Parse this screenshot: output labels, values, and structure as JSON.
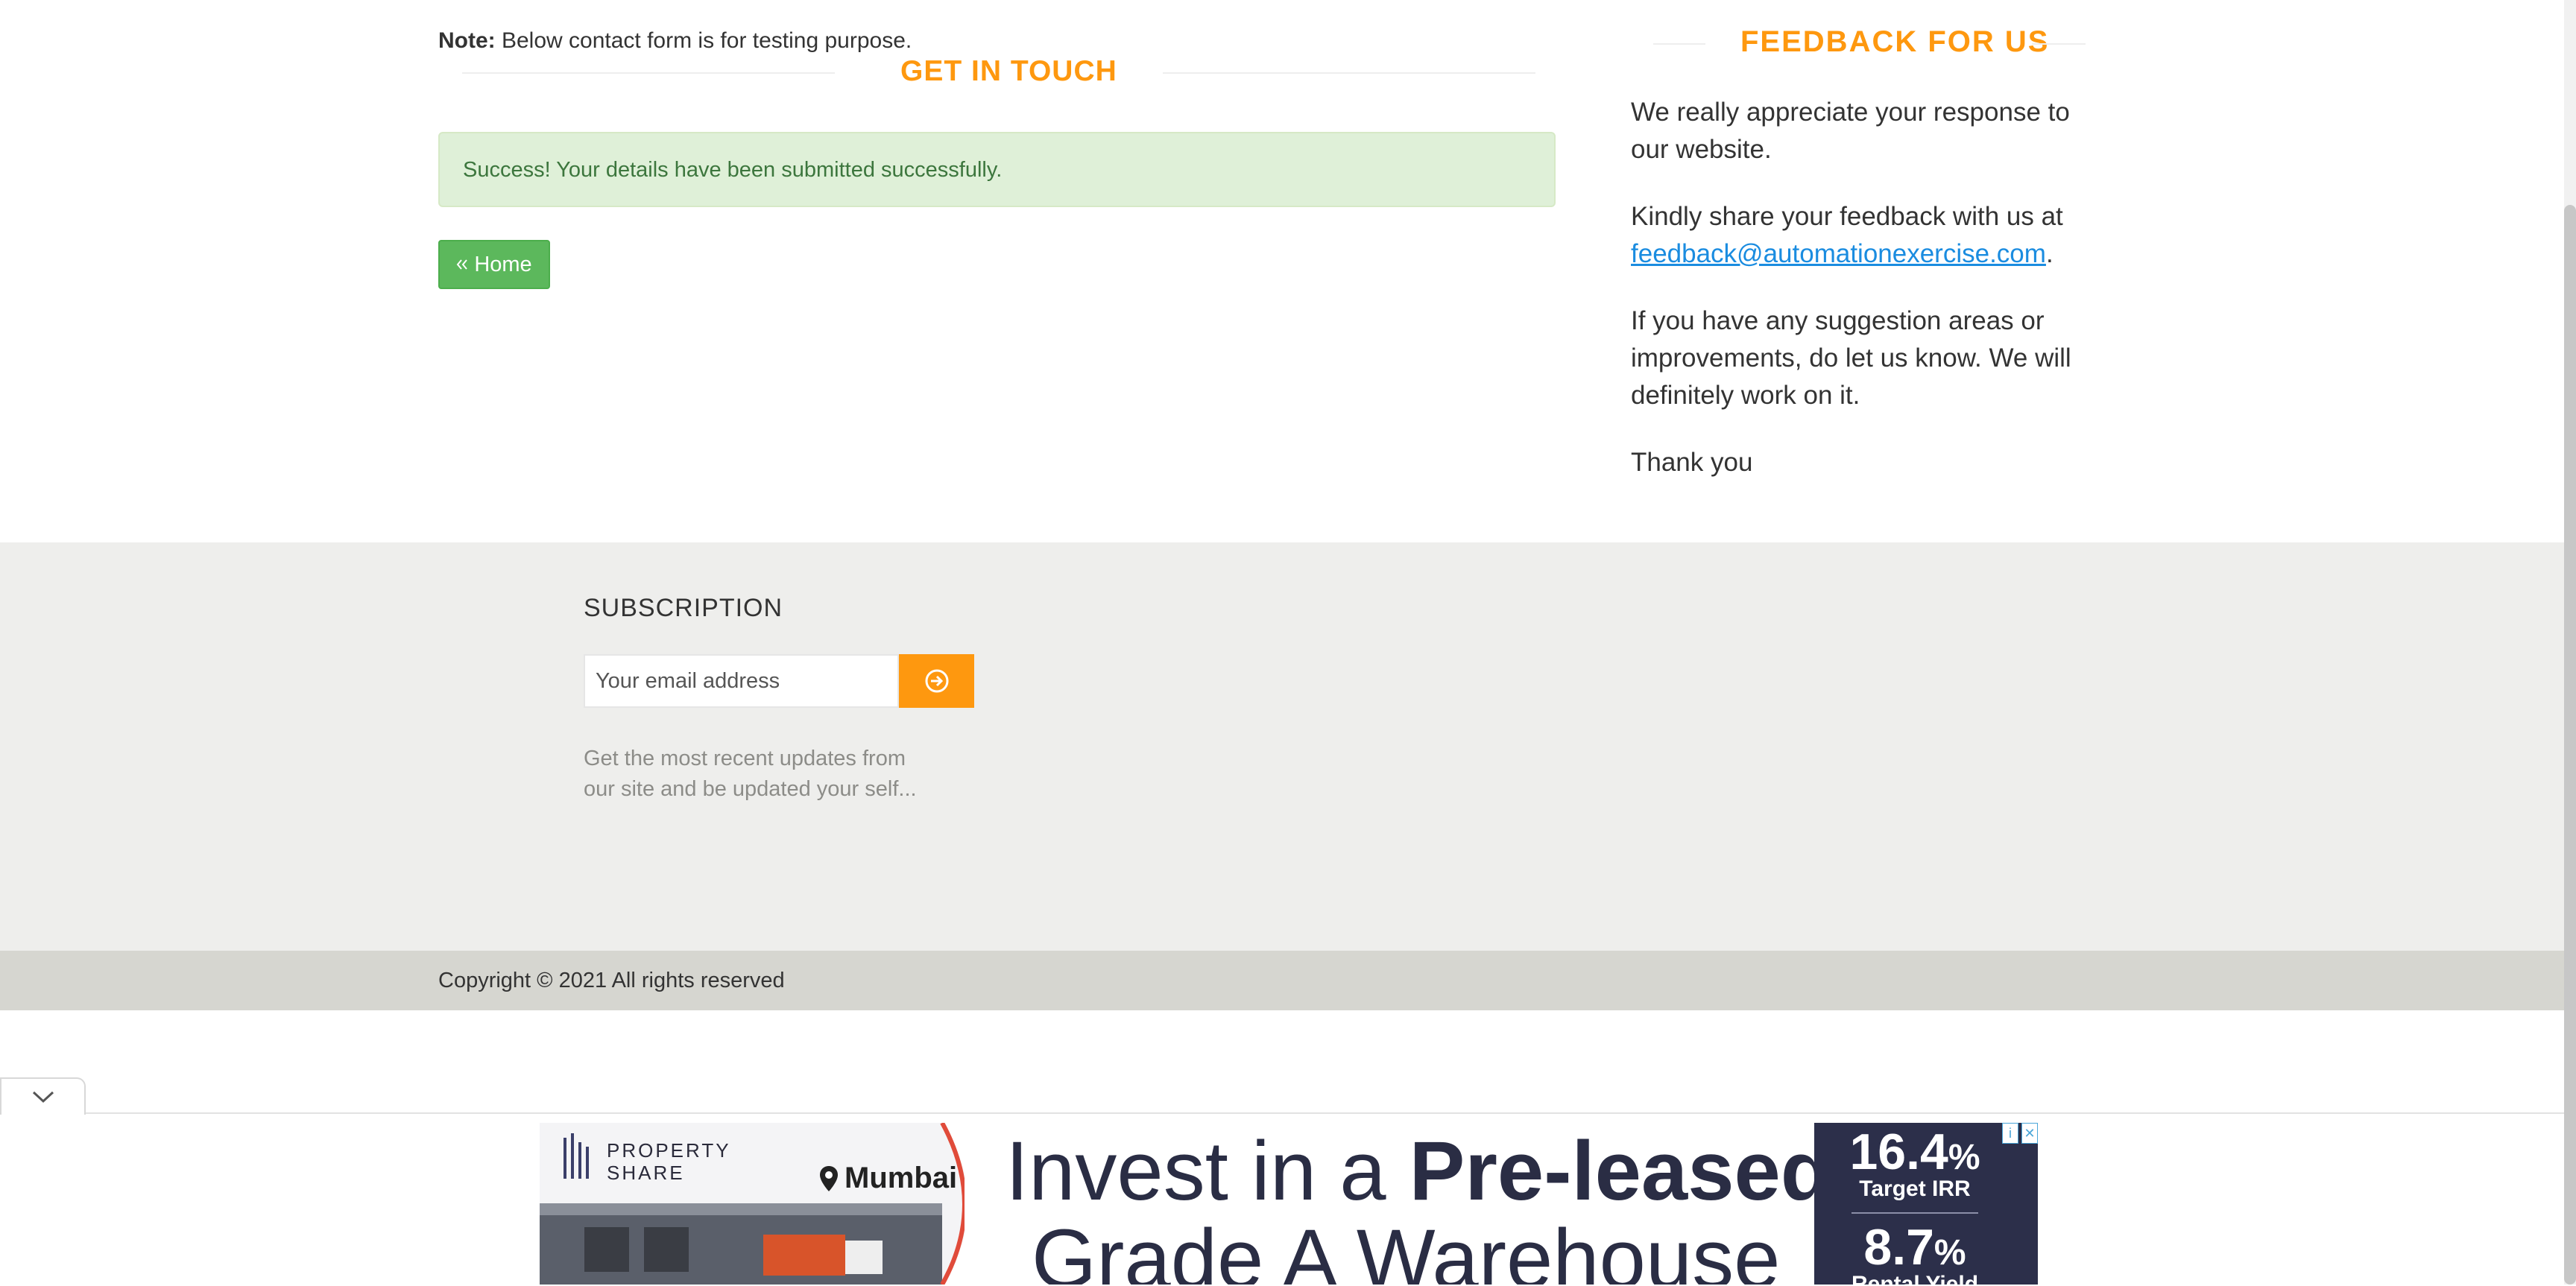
{
  "contact": {
    "note_label": "Note:",
    "note_text": " Below contact form is for testing purpose.",
    "title": "GET IN TOUCH",
    "success_message": "Success! Your details have been submitted successfully.",
    "home_label": "Home",
    "home_icon": "double-chevron-left-icon"
  },
  "feedback": {
    "title": "FEEDBACK FOR US",
    "p1": "We really appreciate your response to our website.",
    "p2_prefix": "Kindly share your feedback with us at",
    "p2_email": "feedback@automationexercise.com",
    "p2_suffix": ".",
    "p3": "If you have any suggestion areas or improvements, do let us know. We will definitely work on it.",
    "p4": "Thank you"
  },
  "footer": {
    "subscription_title": "SUBSCRIPTION",
    "email_placeholder": "Your email address",
    "subscribe_icon": "arrow-circle-right-icon",
    "description": "Get the most recent updates from our site and be updated your self...",
    "copyright": "Copyright © 2021 All rights reserved"
  },
  "ad": {
    "collapse_icon": "chevron-down-icon",
    "brand_line1": "PROPERTY",
    "brand_line2": "SHARE",
    "location": "Mumbai",
    "headline_part1": "Invest in a ",
    "headline_bold": "Pre-leased",
    "headline_line2": "Grade A Warehouse",
    "stat1_value": "16.4",
    "stat1_unit": "%",
    "stat1_label": "Target IRR",
    "stat2_value": "8.7",
    "stat2_unit": "%",
    "stat2_label": "Rental Yield",
    "choices_info": "i",
    "choices_close": "✕"
  },
  "colors": {
    "accent": "#FE980F",
    "success_bg": "#dff0d8",
    "success_text": "#3c763d",
    "home_button": "#5cb85c",
    "link": "#1a8ce0"
  }
}
